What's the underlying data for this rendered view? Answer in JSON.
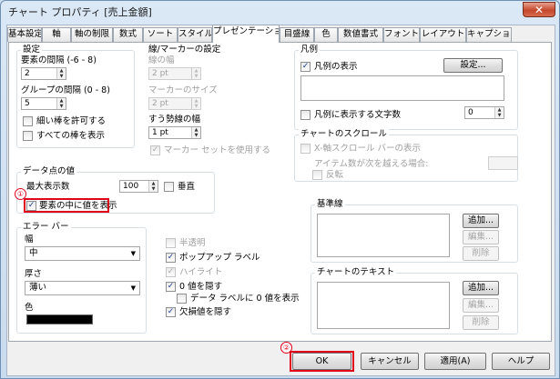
{
  "window": {
    "title": "チャート プロパティ [売上金額]",
    "close_label": "✕"
  },
  "tabs": [
    {
      "label": "基本設定"
    },
    {
      "label": "軸"
    },
    {
      "label": "軸の制限"
    },
    {
      "label": "数式"
    },
    {
      "label": "ソート"
    },
    {
      "label": "スタイル"
    },
    {
      "label": "プレゼンテーション",
      "active": true
    },
    {
      "label": "目盛線"
    },
    {
      "label": "色"
    },
    {
      "label": "数値書式"
    },
    {
      "label": "フォント"
    },
    {
      "label": "レイアウト"
    },
    {
      "label": "キャプション"
    }
  ],
  "settings": {
    "group_label": "設定",
    "bar_spacing_label": "要素の間隔 (-6 - 8)",
    "bar_spacing_value": "2",
    "group_spacing_label": "グループの間隔 (0 - 8)",
    "group_spacing_value": "5",
    "allow_thin_bars_label": "細い棒を許可する",
    "allow_thin_bars_checked": false,
    "show_all_bars_label": "すべての棒を表示",
    "show_all_bars_checked": false
  },
  "line_symbol": {
    "group_label": "線/マーカーの設定",
    "line_width_label": "線の幅",
    "line_width_value": "2 pt",
    "marker_size_label": "マーカーのサイズ",
    "marker_size_value": "2 pt",
    "stick_width_label": "すう勢線の幅",
    "stick_width_value": "1 pt",
    "use_full_symbol_label": "マーカー セットを使用する",
    "use_full_symbol_checked": true
  },
  "data_values": {
    "group_label": "データ点の値",
    "max_values_label": "最大表示数",
    "max_values_value": "100",
    "vertical_label": "垂直",
    "vertical_checked": false,
    "values_inside_label": "要素の中に値を表示",
    "values_inside_checked": true,
    "marker_1": "①"
  },
  "error_bars": {
    "group_label": "エラー バー",
    "width_label": "幅",
    "width_value": "中",
    "thickness_label": "厚さ",
    "thickness_value": "薄い",
    "color_label": "色",
    "color_value": "#000000"
  },
  "popups": {
    "semi_transparent_label": "半透明",
    "semi_transparent_checked": false,
    "popup_labels_label": "ポップアップ ラベル",
    "popup_labels_checked": true,
    "highlight_label": "ハイライト",
    "highlight_checked": true,
    "suppress_zero_label": "0 値を隠す",
    "suppress_zero_checked": true,
    "data_label_zero_label": "データ ラベルに 0 値を表示",
    "data_label_zero_checked": false,
    "suppress_missing_label": "欠損値を隠す",
    "suppress_missing_checked": true
  },
  "legend": {
    "group_label": "凡例",
    "show_legend_label": "凡例の表示",
    "show_legend_checked": true,
    "settings_button": "設定...",
    "limit_chars_label": "凡例に表示する文字数",
    "limit_chars_checked": false,
    "limit_chars_value": "0"
  },
  "chart_scroll": {
    "group_label": "チャートのスクロール",
    "x_scrollbar_label": "X-軸スクロール バーの表示",
    "x_scrollbar_checked": false,
    "when_exceeds_label": "アイテム数が次を越える場合:",
    "reversed_label": "反転",
    "reversed_checked": false
  },
  "reference_lines": {
    "group_label": "基準線",
    "add_button": "追加...",
    "edit_button": "編集...",
    "delete_button": "削除"
  },
  "text_in_chart": {
    "group_label": "チャートのテキスト",
    "add_button": "追加...",
    "edit_button": "編集...",
    "delete_button": "削除"
  },
  "footer": {
    "ok_button": "OK",
    "cancel_button": "キャンセル",
    "apply_button": "適用(A)",
    "help_button": "ヘルプ",
    "marker_2": "②"
  },
  "colors": {
    "highlight_red": "#e1001a",
    "checkmark_blue": "#1b3f8f"
  }
}
